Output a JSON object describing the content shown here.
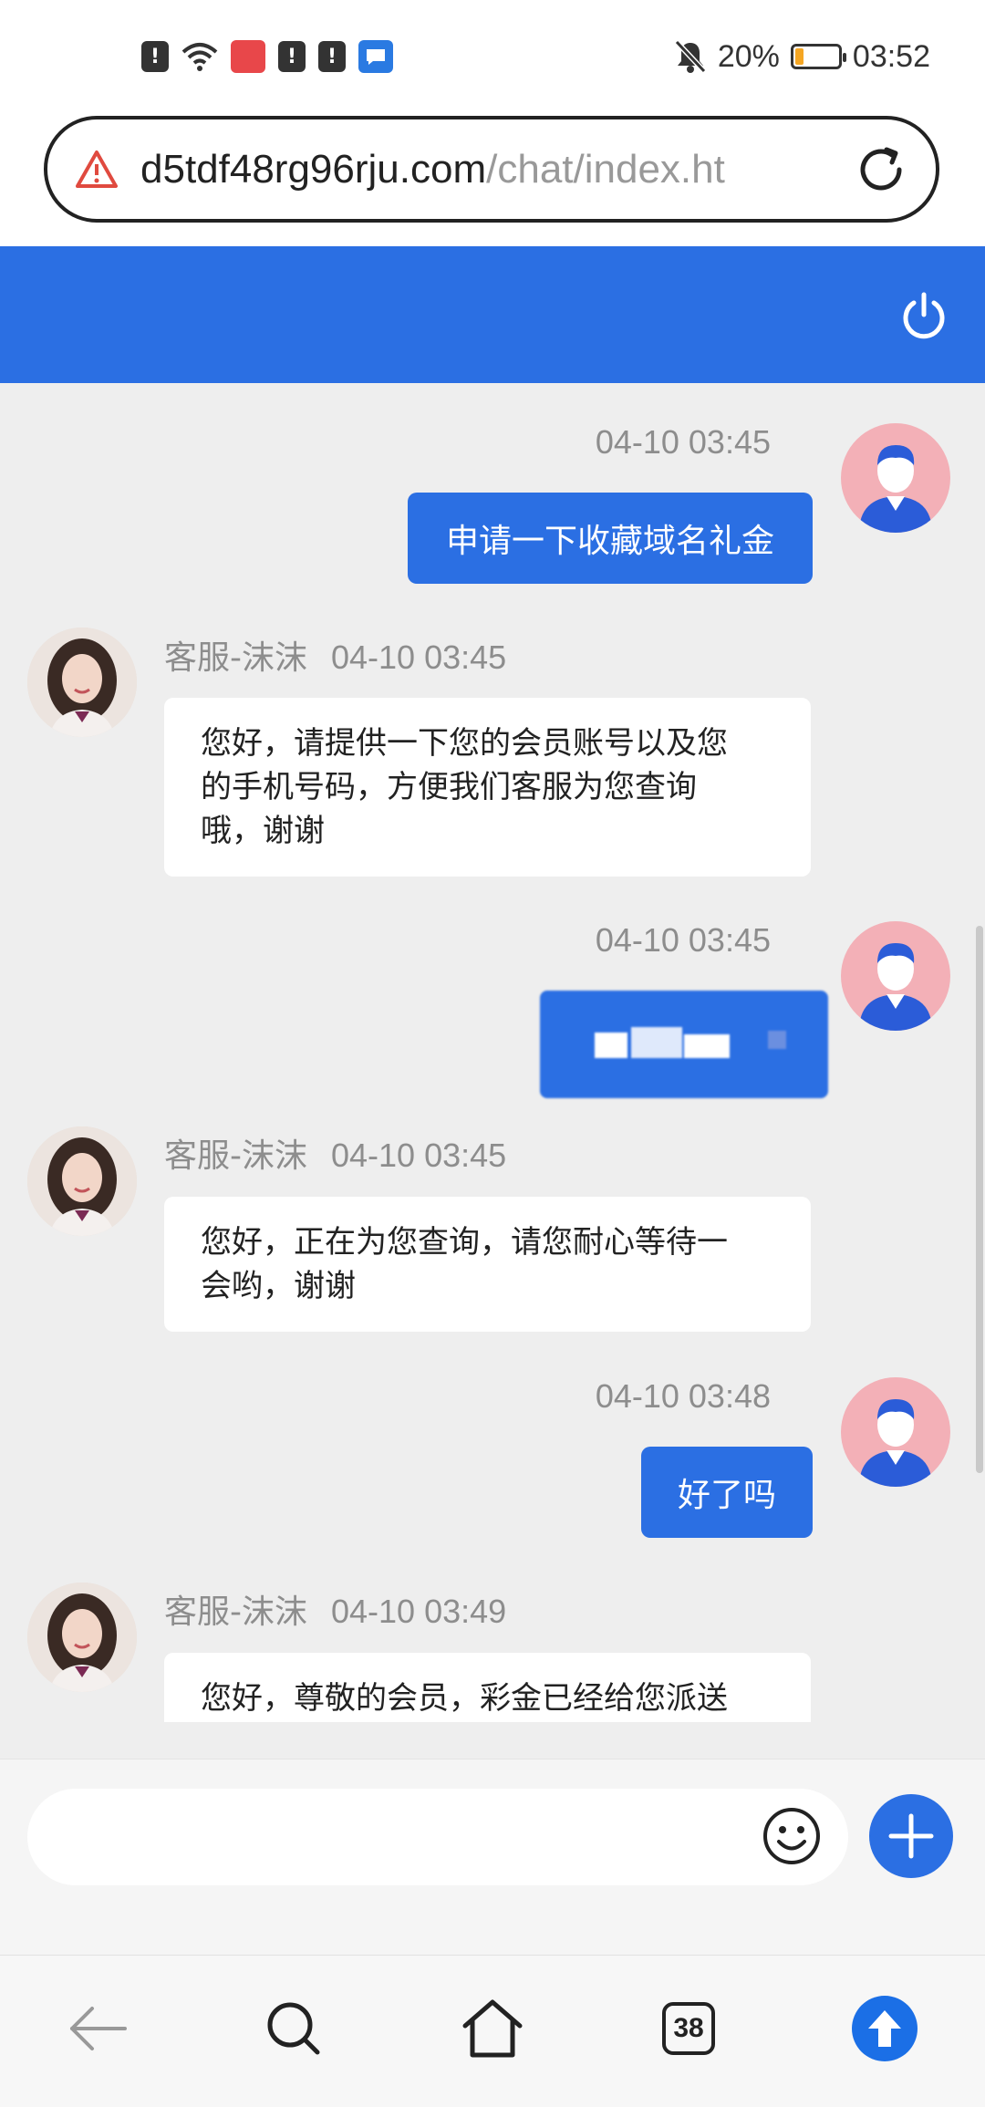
{
  "status_bar": {
    "battery_percent": "20%",
    "battery_level": 0.2,
    "time": "03:52",
    "notification_icons": [
      "alert-icon",
      "wifi-icon",
      "huawei-app-icon",
      "alert-icon",
      "alert-icon",
      "message-app-icon"
    ],
    "mute_icon": "bell-off-icon"
  },
  "browser": {
    "url_domain": "d5tdf48rg96rju.com",
    "url_path": "/chat/index.ht",
    "security_icon": "warning-triangle-icon",
    "reload_icon": "reload-icon"
  },
  "header": {
    "power_icon": "power-icon",
    "color": "#2b6fe3"
  },
  "messages": [
    {
      "from": "me",
      "time": "04-10 03:45",
      "text": "申请一下收藏域名礼金"
    },
    {
      "from": "agent",
      "name": "客服-沫沫",
      "time": "04-10 03:45",
      "lines": [
        "您好，请提供一下您的会员账号以及您",
        "的手机号码，方便我们客服为您查询",
        "哦，谢谢"
      ]
    },
    {
      "from": "me",
      "time": "04-10 03:45",
      "text": ""
    },
    {
      "from": "agent",
      "name": "客服-沫沫",
      "time": "04-10 03:45",
      "lines": [
        "您好，正在为您查询，请您耐心等待一",
        "会哟，谢谢"
      ]
    },
    {
      "from": "me",
      "time": "04-10 03:48",
      "text": "好了吗"
    },
    {
      "from": "agent",
      "name": "客服-沫沫",
      "time": "04-10 03:49",
      "lines": [
        "您好，尊敬的会员，彩金已经给您派送"
      ]
    }
  ],
  "composer": {
    "placeholder": "",
    "emoji_icon": "smiley-icon",
    "add_icon": "plus-icon"
  },
  "bottom_nav": {
    "back_icon": "back-arrow-icon",
    "search_icon": "search-icon",
    "home_icon": "home-icon",
    "tabs_count": "38",
    "upload_icon": "upload-arrow-icon"
  },
  "colors": {
    "accent": "#2b6fe3",
    "chat_background": "#eeeeee"
  }
}
